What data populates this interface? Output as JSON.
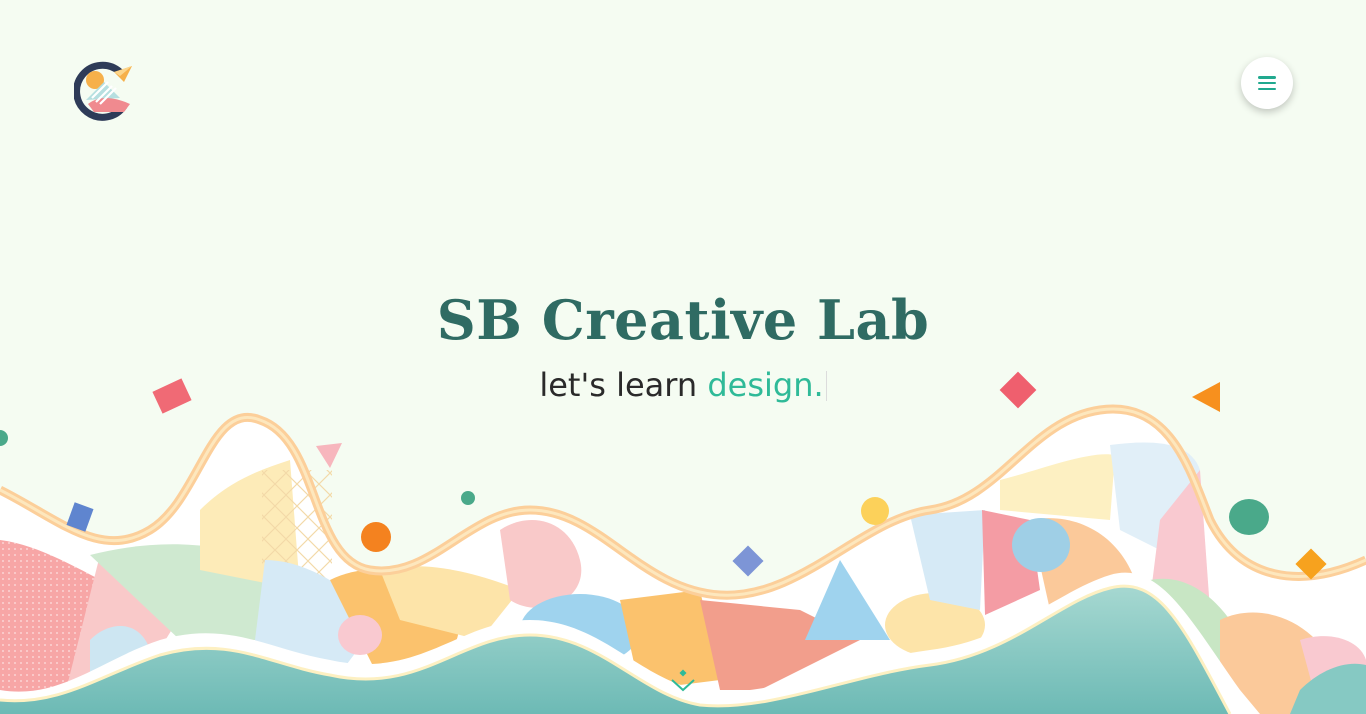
{
  "header": {
    "logo_icon": "sb-creative-lab-logo",
    "menu_icon": "hamburger-menu-icon"
  },
  "hero": {
    "title": "SB Creative Lab",
    "subtitle_lead": "let's learn ",
    "subtitle_accent": "design."
  },
  "scroll": {
    "icon": "chevron-down-icon"
  },
  "colors": {
    "background": "#f5fcf2",
    "title": "#2f6b63",
    "accent": "#2fba98",
    "menu_icon": "#21a98f",
    "hills_teal": "#86c9c3",
    "wave_outline": "#fccf9a"
  }
}
